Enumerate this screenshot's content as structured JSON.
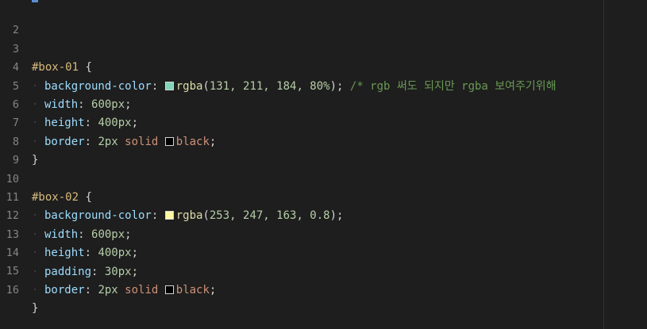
{
  "editor": {
    "lines": [
      {
        "num": "2"
      },
      {
        "num": "3",
        "selector": "#box-01",
        "open": "{"
      },
      {
        "num": "4",
        "prop": "background-color",
        "fn": "rgba",
        "args": "131, 211, 184, 80%",
        "swatch": "#83d3b8",
        "comment": "/* rgb 써도 되지만 rgba 보여주기위해"
      },
      {
        "num": "5",
        "prop": "width",
        "value": "600px"
      },
      {
        "num": "6",
        "prop": "height",
        "value": "400px"
      },
      {
        "num": "7",
        "prop": "border",
        "value_num": "2px",
        "value_kw": "solid",
        "swatch": "#000000",
        "color_kw": "black"
      },
      {
        "num": "8",
        "close": "}"
      },
      {
        "num": "9"
      },
      {
        "num": "10",
        "selector": "#box-02",
        "open": "{"
      },
      {
        "num": "11",
        "prop": "background-color",
        "fn": "rgba",
        "args": "253, 247, 163, 0.8",
        "swatch": "#fdf7a3"
      },
      {
        "num": "12",
        "prop": "width",
        "value": "600px"
      },
      {
        "num": "13",
        "prop": "height",
        "value": "400px"
      },
      {
        "num": "14",
        "prop": "padding",
        "value": "30px"
      },
      {
        "num": "15",
        "prop": "border",
        "value_num": "2px",
        "value_kw": "solid",
        "swatch": "#000000",
        "color_kw": "black"
      },
      {
        "num": "16",
        "close": "}"
      }
    ]
  }
}
